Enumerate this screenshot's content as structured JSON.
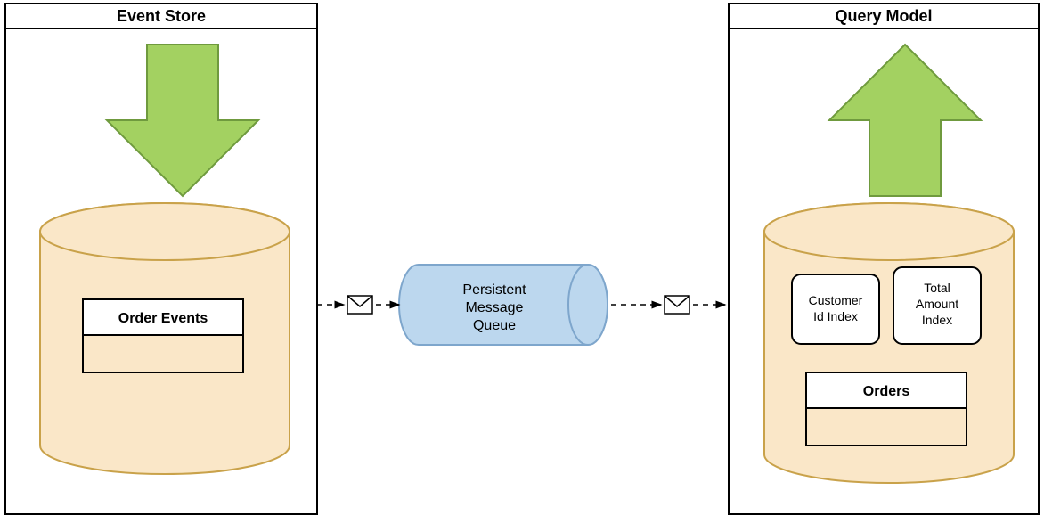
{
  "left_panel": {
    "title": "Event Store",
    "table_label": "Order Events"
  },
  "right_panel": {
    "title": "Query Model",
    "index1_line1": "Customer",
    "index1_line2": "Id Index",
    "index2_line1": "Total",
    "index2_line2": "Amount",
    "index2_line3": "Index",
    "table_label": "Orders"
  },
  "queue": {
    "line1": "Persistent",
    "line2": "Message",
    "line3": "Queue"
  },
  "colors": {
    "panel_stroke": "#000000",
    "db_fill": "#fae7c8",
    "db_stroke": "#c9a24a",
    "arrow_fill": "#a3d161",
    "arrow_stroke": "#6f9a3e",
    "queue_fill": "#bcd7ee",
    "queue_stroke": "#7ea6cc",
    "white": "#ffffff"
  }
}
